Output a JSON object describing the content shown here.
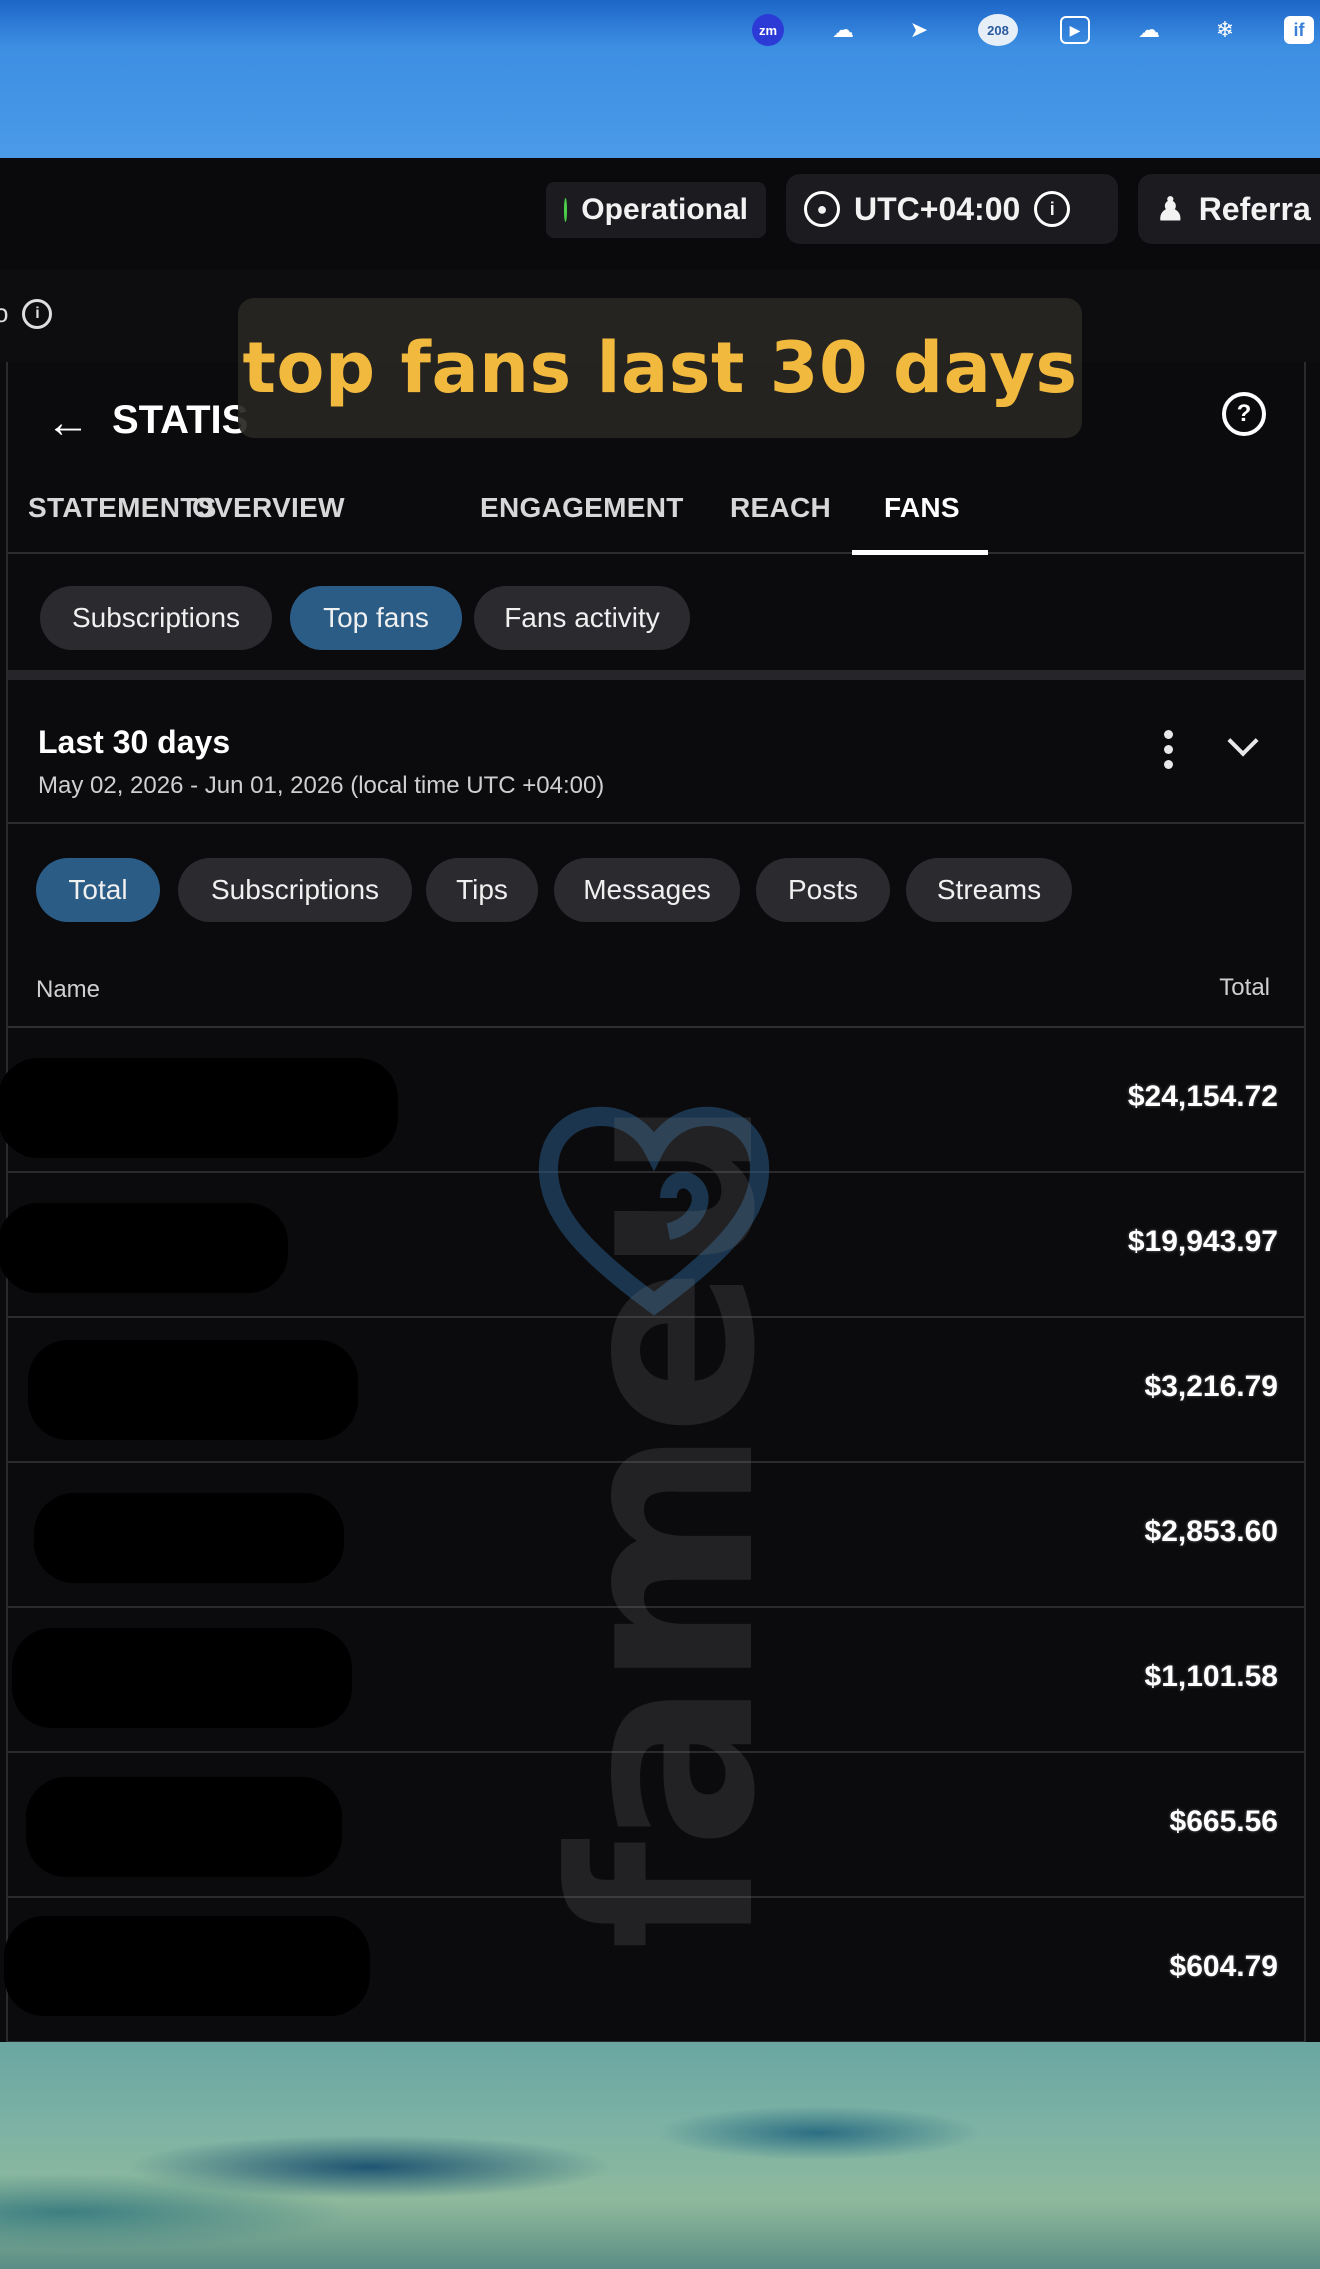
{
  "caption": "top fans last 30 days",
  "menubar": {
    "icons": [
      "zoom-icon",
      "cloud-storage-icon",
      "cast-icon",
      "weather-badge-icon",
      "screen-share-icon",
      "cloud-sync-icon",
      "snowflake-icon",
      "info-app-icon"
    ],
    "zoom_label": "zm",
    "badge_value": "208",
    "last_icon_label": "if"
  },
  "appbar": {
    "status_label": "Operational",
    "timezone_label": "UTC+04:00",
    "referral_label": "Referra"
  },
  "substrip": {
    "fragment": "o"
  },
  "page": {
    "title": "STATIS"
  },
  "tabs": [
    {
      "label": "STATEMENTS",
      "active": false
    },
    {
      "label": "OVERVIEW",
      "active": false
    },
    {
      "label": "ENGAGEMENT",
      "active": false
    },
    {
      "label": "REACH",
      "active": false
    },
    {
      "label": "FANS",
      "active": true
    }
  ],
  "subtabs": [
    {
      "label": "Subscriptions",
      "active": false
    },
    {
      "label": "Top fans",
      "active": true
    },
    {
      "label": "Fans activity",
      "active": false
    }
  ],
  "range": {
    "title": "Last 30 days",
    "subtitle": "May 02, 2026 - Jun 01, 2026 (local time UTC +04:00)"
  },
  "filters": [
    {
      "label": "Total",
      "active": true
    },
    {
      "label": "Subscriptions",
      "active": false
    },
    {
      "label": "Tips",
      "active": false
    },
    {
      "label": "Messages",
      "active": false
    },
    {
      "label": "Posts",
      "active": false
    },
    {
      "label": "Streams",
      "active": false
    }
  ],
  "table": {
    "columns": [
      "Name",
      "Total"
    ],
    "rows": [
      {
        "name": "",
        "total": "$24,154.72"
      },
      {
        "name": "",
        "total": "$19,943.97"
      },
      {
        "name": "",
        "total": "$3,216.79"
      },
      {
        "name": "",
        "total": "$2,853.60"
      },
      {
        "name": "",
        "total": "$1,101.58"
      },
      {
        "name": "",
        "total": "$665.56"
      },
      {
        "name": "",
        "total": "$604.79"
      }
    ]
  },
  "watermark": {
    "text": "fameu",
    "icon": "heart-logo-icon"
  }
}
